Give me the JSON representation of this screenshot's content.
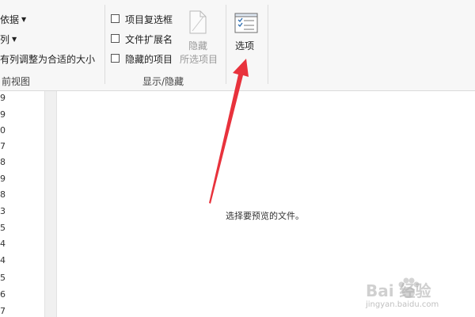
{
  "ribbon": {
    "layout_group": {
      "sort_by_label": "依据",
      "add_columns_label": "列",
      "fit_columns_label": "有列调整为合适的大小",
      "group_label": "前视图"
    },
    "show_hide_group": {
      "item_checkboxes_label": "项目复选框",
      "file_extensions_label": "文件扩展名",
      "hidden_items_label": "隐藏的项目",
      "hide_selected_line1": "隐藏",
      "hide_selected_line2": "所选项目",
      "group_label": "显示/隐藏",
      "item_checkboxes_checked": false,
      "file_extensions_checked": false,
      "hidden_items_checked": false
    },
    "options_group": {
      "options_label": "选项"
    }
  },
  "nav_pane": {
    "lines": [
      "9",
      "9",
      "0",
      "7",
      "8",
      "9",
      "8",
      "3",
      "5",
      "4",
      "4",
      "5",
      "6",
      "7"
    ]
  },
  "preview": {
    "message": "选择要预览的文件。"
  },
  "annotation": {
    "arrow_color": "#e8323c"
  },
  "watermark": {
    "line1": "Bai 经验",
    "line2": "jingyan.baidu.com"
  }
}
